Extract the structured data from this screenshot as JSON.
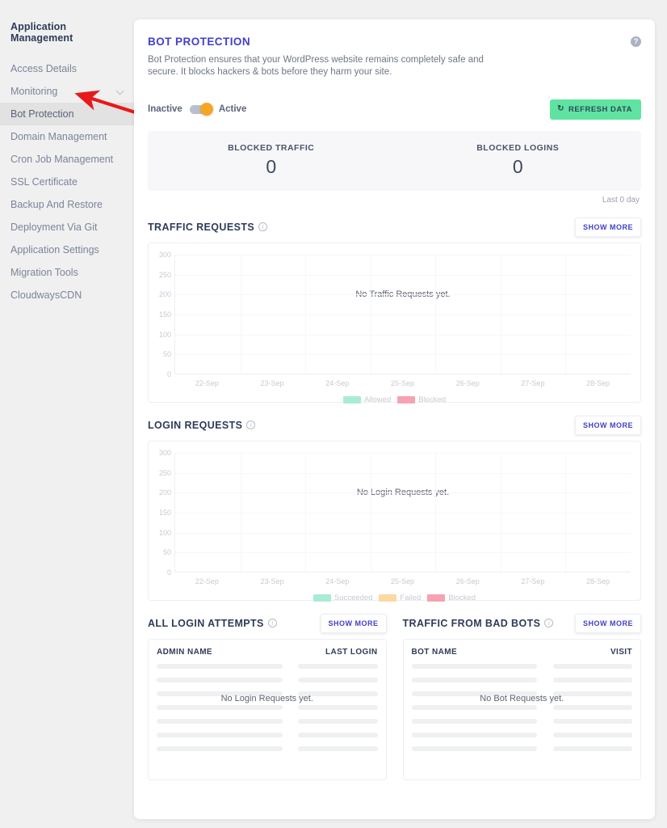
{
  "sidebar": {
    "title": "Application Management",
    "items": [
      {
        "label": "Access Details",
        "active": false,
        "chevron": false
      },
      {
        "label": "Monitoring",
        "active": false,
        "chevron": true
      },
      {
        "label": "Bot Protection",
        "active": true,
        "chevron": false
      },
      {
        "label": "Domain Management",
        "active": false,
        "chevron": false
      },
      {
        "label": "Cron Job Management",
        "active": false,
        "chevron": false
      },
      {
        "label": "SSL Certificate",
        "active": false,
        "chevron": false
      },
      {
        "label": "Backup And Restore",
        "active": false,
        "chevron": false
      },
      {
        "label": "Deployment Via Git",
        "active": false,
        "chevron": false
      },
      {
        "label": "Application Settings",
        "active": false,
        "chevron": false
      },
      {
        "label": "Migration Tools",
        "active": false,
        "chevron": false
      },
      {
        "label": "CloudwaysCDN",
        "active": false,
        "chevron": false
      }
    ]
  },
  "annotation": {
    "arrow_color": "#e8191b"
  },
  "header": {
    "title": "BOT PROTECTION",
    "description": "Bot Protection ensures that your WordPress website remains completely safe and secure. It blocks hackers & bots before they harm your site.",
    "help_icon": "question-mark-icon",
    "help_glyph": "?"
  },
  "toggle": {
    "left_label": "Inactive",
    "right_label": "Active",
    "state": "Active",
    "knob_color": "#f5a623",
    "track_color": "#b9bfcc"
  },
  "refresh_button": {
    "label": "REFRESH DATA",
    "glyph": "↻",
    "color": "#5fe3a1"
  },
  "stats": {
    "items": [
      {
        "label": "BLOCKED TRAFFIC",
        "value": "0"
      },
      {
        "label": "BLOCKED LOGINS",
        "value": "0"
      }
    ],
    "footnote": "Last 0 day"
  },
  "show_more_label": "SHOW MORE",
  "info_glyph": "i",
  "traffic_requests": {
    "title": "TRAFFIC REQUESTS",
    "empty_message": "No Traffic Requests yet."
  },
  "login_requests": {
    "title": "LOGIN REQUESTS",
    "empty_message": "No Login Requests yet."
  },
  "tables": [
    {
      "title": "ALL LOGIN ATTEMPTS",
      "columns": [
        "ADMIN NAME",
        "LAST LOGIN"
      ],
      "empty_message": "No Login Requests yet.",
      "skeleton_rows": 7
    },
    {
      "title": "TRAFFIC FROM BAD BOTS",
      "columns": [
        "BOT NAME",
        "VISIT"
      ],
      "empty_message": "No Bot Requests yet.",
      "skeleton_rows": 7
    }
  ],
  "chart_data": [
    {
      "type": "bar",
      "title": "TRAFFIC REQUESTS",
      "categories": [
        "22-Sep",
        "23-Sep",
        "24-Sep",
        "25-Sep",
        "26-Sep",
        "27-Sep",
        "28-Sep"
      ],
      "series": [
        {
          "name": "Allowed",
          "color": "#a9ecd4",
          "values": [
            0,
            0,
            0,
            0,
            0,
            0,
            0
          ]
        },
        {
          "name": "Blocked",
          "color": "#f5a3b0",
          "values": [
            0,
            0,
            0,
            0,
            0,
            0,
            0
          ]
        }
      ],
      "yticks": [
        0,
        50,
        100,
        150,
        200,
        250,
        300
      ],
      "ylim": [
        0,
        300
      ],
      "xlabel": "",
      "ylabel": "",
      "grid": true,
      "legend_position": "bottom",
      "annotation": "No Traffic Requests yet."
    },
    {
      "type": "bar",
      "title": "LOGIN REQUESTS",
      "categories": [
        "22-Sep",
        "23-Sep",
        "24-Sep",
        "25-Sep",
        "26-Sep",
        "27-Sep",
        "28-Sep"
      ],
      "series": [
        {
          "name": "Succeeded",
          "color": "#a9ecd4",
          "values": [
            0,
            0,
            0,
            0,
            0,
            0,
            0
          ]
        },
        {
          "name": "Failed",
          "color": "#fbd9a5",
          "values": [
            0,
            0,
            0,
            0,
            0,
            0,
            0
          ]
        },
        {
          "name": "Blocked",
          "color": "#f5a3b0",
          "values": [
            0,
            0,
            0,
            0,
            0,
            0,
            0
          ]
        }
      ],
      "yticks": [
        0,
        50,
        100,
        150,
        200,
        250,
        300
      ],
      "ylim": [
        0,
        300
      ],
      "xlabel": "",
      "ylabel": "",
      "grid": true,
      "legend_position": "bottom",
      "annotation": "No Login Requests yet."
    }
  ]
}
